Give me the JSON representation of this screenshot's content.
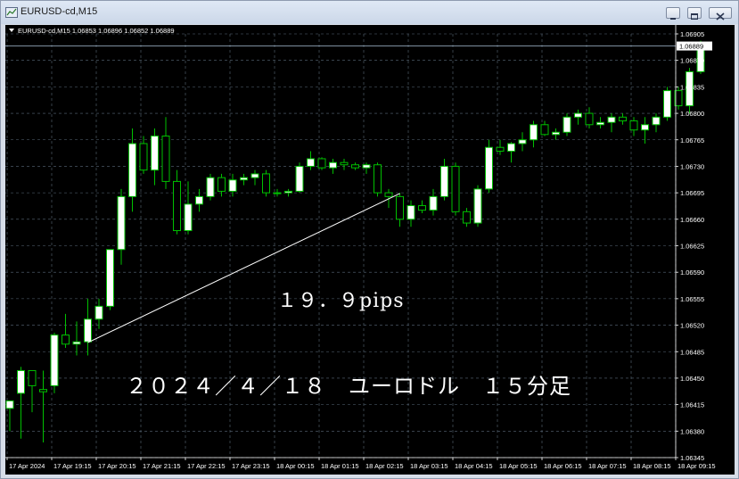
{
  "window": {
    "title": "EURUSD-cd,M15",
    "controls": [
      "minimize",
      "maximize",
      "close"
    ]
  },
  "chart_header": {
    "label": "EURUSD-cd,M15  1.06853 1.06896 1.06852 1.06889"
  },
  "annotations": {
    "pips_text": "１９．９pips",
    "caption_text": "２０２４／４／１８　ユーロドル　１５分足"
  },
  "current_price_label": "1.06889",
  "colors": {
    "background": "#000000",
    "grid": "#5a6a7a",
    "up_candle_body": "#ffffff",
    "down_candle_body": "#000000",
    "candle_outline": "#00c000",
    "text": "#ffffff",
    "price_line": "#8fa3b5"
  },
  "chart_data": {
    "type": "candlestick",
    "symbol": "EURUSD-cd",
    "timeframe": "M15",
    "ylim": [
      1.06345,
      1.06905
    ],
    "y_ticks": [
      "1.06905",
      "1.06870",
      "1.06835",
      "1.06800",
      "1.06765",
      "1.06730",
      "1.06695",
      "1.06660",
      "1.06625",
      "1.06590",
      "1.06555",
      "1.06520",
      "1.06485",
      "1.06450",
      "1.06415",
      "1.06380",
      "1.06345"
    ],
    "x_ticks": [
      "17 Apr 2024",
      "17 Apr 19:15",
      "17 Apr 20:15",
      "17 Apr 21:15",
      "17 Apr 22:15",
      "17 Apr 23:15",
      "18 Apr 00:15",
      "18 Apr 01:15",
      "18 Apr 02:15",
      "18 Apr 03:15",
      "18 Apr 04:15",
      "18 Apr 05:15",
      "18 Apr 06:15",
      "18 Apr 07:15",
      "18 Apr 08:15",
      "18 Apr 09:15"
    ],
    "bars_per_tick": 4,
    "candles": [
      {
        "o": 1.0641,
        "h": 1.0642,
        "l": 1.0638,
        "c": 1.0642
      },
      {
        "o": 1.0643,
        "h": 1.06465,
        "l": 1.0637,
        "c": 1.0646
      },
      {
        "o": 1.0646,
        "h": 1.0646,
        "l": 1.06405,
        "c": 1.0644
      },
      {
        "o": 1.06435,
        "h": 1.0646,
        "l": 1.06365,
        "c": 1.06432
      },
      {
        "o": 1.0644,
        "h": 1.0651,
        "l": 1.0643,
        "c": 1.06507
      },
      {
        "o": 1.06507,
        "h": 1.06535,
        "l": 1.0649,
        "c": 1.06495
      },
      {
        "o": 1.06495,
        "h": 1.06525,
        "l": 1.0648,
        "c": 1.06498
      },
      {
        "o": 1.06498,
        "h": 1.06555,
        "l": 1.0648,
        "c": 1.06528
      },
      {
        "o": 1.06528,
        "h": 1.06555,
        "l": 1.06515,
        "c": 1.06545
      },
      {
        "o": 1.06545,
        "h": 1.0662,
        "l": 1.0654,
        "c": 1.0662
      },
      {
        "o": 1.0662,
        "h": 1.067,
        "l": 1.066,
        "c": 1.0669
      },
      {
        "o": 1.0669,
        "h": 1.0678,
        "l": 1.0667,
        "c": 1.0676
      },
      {
        "o": 1.0676,
        "h": 1.0677,
        "l": 1.0672,
        "c": 1.06725
      },
      {
        "o": 1.06725,
        "h": 1.0678,
        "l": 1.06705,
        "c": 1.0677
      },
      {
        "o": 1.0677,
        "h": 1.06795,
        "l": 1.067,
        "c": 1.0671
      },
      {
        "o": 1.0671,
        "h": 1.06725,
        "l": 1.0664,
        "c": 1.06645
      },
      {
        "o": 1.06645,
        "h": 1.0671,
        "l": 1.0664,
        "c": 1.0668
      },
      {
        "o": 1.0668,
        "h": 1.067,
        "l": 1.0667,
        "c": 1.0669
      },
      {
        "o": 1.0669,
        "h": 1.0672,
        "l": 1.06685,
        "c": 1.06715
      },
      {
        "o": 1.06715,
        "h": 1.0672,
        "l": 1.0669,
        "c": 1.06697
      },
      {
        "o": 1.06697,
        "h": 1.0672,
        "l": 1.0669,
        "c": 1.06712
      },
      {
        "o": 1.06712,
        "h": 1.0672,
        "l": 1.06705,
        "c": 1.06715
      },
      {
        "o": 1.06715,
        "h": 1.06725,
        "l": 1.06705,
        "c": 1.0672
      },
      {
        "o": 1.0672,
        "h": 1.06725,
        "l": 1.0669,
        "c": 1.06695
      },
      {
        "o": 1.06695,
        "h": 1.067,
        "l": 1.0669,
        "c": 1.06695
      },
      {
        "o": 1.06695,
        "h": 1.067,
        "l": 1.0669,
        "c": 1.06697
      },
      {
        "o": 1.06697,
        "h": 1.06735,
        "l": 1.06695,
        "c": 1.0673
      },
      {
        "o": 1.0673,
        "h": 1.0675,
        "l": 1.06725,
        "c": 1.0674
      },
      {
        "o": 1.0674,
        "h": 1.06742,
        "l": 1.06725,
        "c": 1.06728
      },
      {
        "o": 1.06728,
        "h": 1.0674,
        "l": 1.0672,
        "c": 1.06735
      },
      {
        "o": 1.06735,
        "h": 1.0674,
        "l": 1.06725,
        "c": 1.06732
      },
      {
        "o": 1.06732,
        "h": 1.06735,
        "l": 1.06725,
        "c": 1.06728
      },
      {
        "o": 1.06728,
        "h": 1.06735,
        "l": 1.0672,
        "c": 1.06732
      },
      {
        "o": 1.06732,
        "h": 1.06735,
        "l": 1.0669,
        "c": 1.06695
      },
      {
        "o": 1.06695,
        "h": 1.067,
        "l": 1.06675,
        "c": 1.0669
      },
      {
        "o": 1.0669,
        "h": 1.06695,
        "l": 1.0665,
        "c": 1.0666
      },
      {
        "o": 1.0666,
        "h": 1.06685,
        "l": 1.0665,
        "c": 1.06678
      },
      {
        "o": 1.06678,
        "h": 1.06685,
        "l": 1.06668,
        "c": 1.06672
      },
      {
        "o": 1.06672,
        "h": 1.067,
        "l": 1.06665,
        "c": 1.0669
      },
      {
        "o": 1.0669,
        "h": 1.0674,
        "l": 1.06685,
        "c": 1.0673
      },
      {
        "o": 1.0673,
        "h": 1.06735,
        "l": 1.06665,
        "c": 1.0667
      },
      {
        "o": 1.0667,
        "h": 1.06675,
        "l": 1.0665,
        "c": 1.06655
      },
      {
        "o": 1.06655,
        "h": 1.06705,
        "l": 1.0665,
        "c": 1.067
      },
      {
        "o": 1.067,
        "h": 1.06765,
        "l": 1.06695,
        "c": 1.06755
      },
      {
        "o": 1.06755,
        "h": 1.06765,
        "l": 1.06745,
        "c": 1.0675
      },
      {
        "o": 1.0675,
        "h": 1.06762,
        "l": 1.06735,
        "c": 1.0676
      },
      {
        "o": 1.0676,
        "h": 1.06775,
        "l": 1.0675,
        "c": 1.06765
      },
      {
        "o": 1.06765,
        "h": 1.0679,
        "l": 1.06755,
        "c": 1.06785
      },
      {
        "o": 1.06785,
        "h": 1.0679,
        "l": 1.0677,
        "c": 1.06772
      },
      {
        "o": 1.06772,
        "h": 1.0678,
        "l": 1.06765,
        "c": 1.06775
      },
      {
        "o": 1.06775,
        "h": 1.068,
        "l": 1.0677,
        "c": 1.06795
      },
      {
        "o": 1.06795,
        "h": 1.06805,
        "l": 1.06785,
        "c": 1.068
      },
      {
        "o": 1.068,
        "h": 1.06808,
        "l": 1.0678,
        "c": 1.06785
      },
      {
        "o": 1.06785,
        "h": 1.06795,
        "l": 1.0678,
        "c": 1.06788
      },
      {
        "o": 1.06788,
        "h": 1.068,
        "l": 1.06775,
        "c": 1.06795
      },
      {
        "o": 1.06795,
        "h": 1.068,
        "l": 1.06785,
        "c": 1.0679
      },
      {
        "o": 1.0679,
        "h": 1.06795,
        "l": 1.0677,
        "c": 1.06778
      },
      {
        "o": 1.06778,
        "h": 1.06795,
        "l": 1.0676,
        "c": 1.06785
      },
      {
        "o": 1.06785,
        "h": 1.068,
        "l": 1.06775,
        "c": 1.06795
      },
      {
        "o": 1.06795,
        "h": 1.06835,
        "l": 1.0679,
        "c": 1.0683
      },
      {
        "o": 1.0683,
        "h": 1.06835,
        "l": 1.06805,
        "c": 1.0681
      },
      {
        "o": 1.0681,
        "h": 1.0686,
        "l": 1.068,
        "c": 1.06855
      },
      {
        "o": 1.06855,
        "h": 1.06896,
        "l": 1.06852,
        "c": 1.06889
      }
    ],
    "trendline": {
      "from": {
        "bar": 7,
        "price": 1.06497
      },
      "to": {
        "bar": 35,
        "price": 1.06694
      }
    }
  }
}
